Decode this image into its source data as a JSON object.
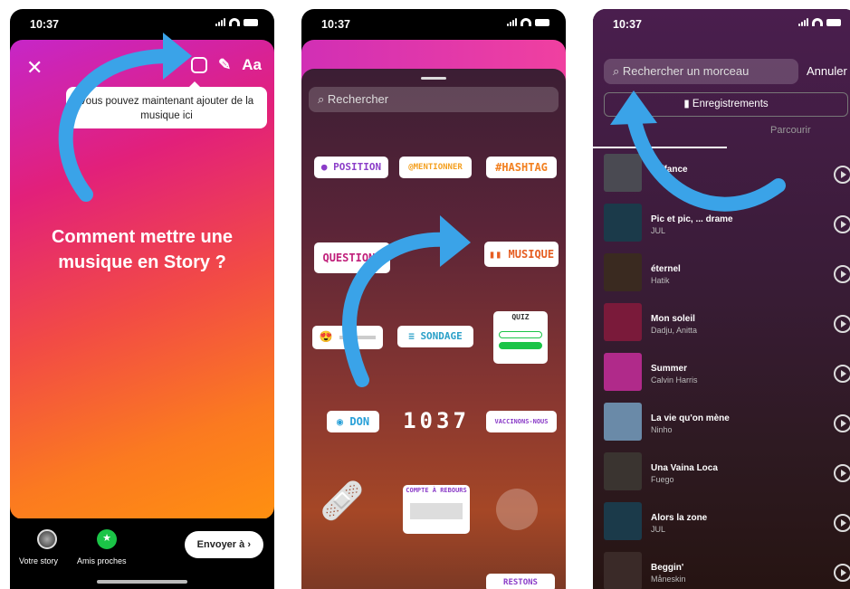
{
  "p1": {
    "time": "10:37",
    "close": "✕",
    "tool_text": "Aa",
    "tooltip": "Vous pouvez maintenant ajouter de la musique ici",
    "title": "Comment mettre une musique en Story ?",
    "your_story": "Votre story",
    "close_friends": "Amis proches",
    "send": "Envoyer à"
  },
  "p2": {
    "time": "10:37",
    "search_placeholder": "Rechercher",
    "stickers": {
      "position": "POSITION",
      "mention": "@MENTIONNER",
      "hashtag": "#HASHTAG",
      "questions": "QUESTIONS",
      "music": "MUSIQUE",
      "sondage": "SONDAGE",
      "quiz": "QUIZ",
      "don": "DON",
      "clock": "1037",
      "vaccin": "VACCINONS-NOUS",
      "compte": "COMPTE À REBOURS",
      "restons": "RESTONS"
    }
  },
  "p3": {
    "time": "10:37",
    "search_placeholder": "Rechercher un morceau",
    "cancel": "Annuler",
    "saved": "Enregistrements",
    "browse": "Parcourir",
    "songs": [
      {
        "title": "...iffance",
        "artist": "",
        "color": "#4a4a52"
      },
      {
        "title": "Pic et pic, ... drame",
        "artist": "JUL",
        "color": "#1b3a4a"
      },
      {
        "title": "éternel",
        "artist": "Hatik",
        "color": "#3a2a20"
      },
      {
        "title": "Mon soleil",
        "artist": "Dadju, Anitta",
        "color": "#7a1a3a"
      },
      {
        "title": "Summer",
        "artist": "Calvin Harris",
        "color": "#b02a8a"
      },
      {
        "title": "La vie qu'on mène",
        "artist": "Ninho",
        "color": "#6a8aa8"
      },
      {
        "title": "Una Vaina Loca",
        "artist": "Fuego",
        "color": "#3a3430"
      },
      {
        "title": "Alors la zone",
        "artist": "JUL",
        "color": "#1b3a4a"
      },
      {
        "title": "Beggin'",
        "artist": "Måneskin",
        "color": "#3a2a28"
      }
    ]
  }
}
